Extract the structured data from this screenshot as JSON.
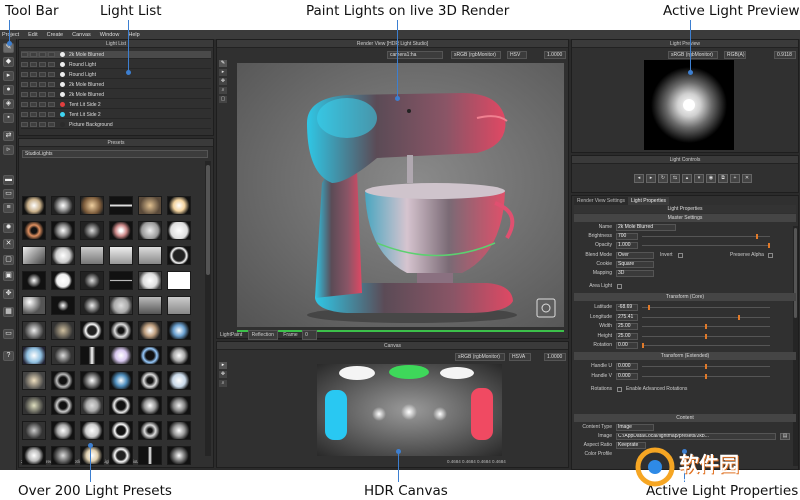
{
  "callouts": {
    "tool_bar": "Tool Bar",
    "light_list": "Light List",
    "paint_lights": "Paint Lights on live 3D Render",
    "active_preview": "Active Light Preview",
    "presets": "Over 200 Light Presets",
    "hdr_canvas": "HDR Canvas",
    "active_props": "Active Light Properties"
  },
  "menu": [
    "Project",
    "Edit",
    "Create",
    "Canvas",
    "Window",
    "Help"
  ],
  "light_list": {
    "title": "Light List",
    "rows": [
      {
        "name": "2k Mole Blurred",
        "color": "#eeeeee",
        "selected": true
      },
      {
        "name": "Round Light",
        "color": "#eeeeee"
      },
      {
        "name": "Round Light",
        "color": "#eeeeee"
      },
      {
        "name": "2k Mole Blurred",
        "color": "#eeeeee"
      },
      {
        "name": "2k Mole Blurred",
        "color": "#eeeeee"
      },
      {
        "name": "Tent Lit Side 2",
        "color": "#e04040"
      },
      {
        "name": "Tent Lit Side 2",
        "color": "#3fd4f0"
      },
      {
        "name": "Picture Background",
        "color": "#2b2b2b"
      }
    ]
  },
  "presets": {
    "title": "Presets",
    "category": "StudioLights",
    "status": "2k Mole Blurred - Tags: Spotlight, PictureLightHFA, StudioLights"
  },
  "render_view": {
    "title": "Render View [HDR Light Studio]",
    "camera": "camera1:ha",
    "colorspace": "sRGB (rgbMonitor)",
    "format": "HSV",
    "zoom": "1.0000",
    "lightpaint_label": "LightPaint",
    "lightpaint_mode": "Reflection",
    "frame_label": "Frame",
    "frame_value": "0"
  },
  "canvas": {
    "title": "Canvas",
    "colorspace": "sRGB (rgbMonitor)",
    "format": "HSVA",
    "zoom": "1.0000",
    "pixel_info": "0.4684 0.4684 0.4684 0.4684"
  },
  "light_preview": {
    "title": "Light Preview",
    "colorspace": "sRGB (rgbMonitor)",
    "format": "RGB(A)",
    "zoom": "0.9118"
  },
  "light_controls": {
    "title": "Light Controls"
  },
  "properties": {
    "tabs": [
      "Render View Settings",
      "Light Properties"
    ],
    "header": "Light Properties",
    "master_settings": "Master Settings",
    "fields": {
      "name_label": "Name",
      "name_value": "2k Mole Blurred",
      "brightness_label": "Brightness",
      "brightness_value": "700",
      "opacity_label": "Opacity",
      "opacity_value": "1.000",
      "blend_label": "Blend Mode",
      "blend_value": "Over",
      "invert_label": "Invert",
      "preserve_alpha_label": "Preserve Alpha",
      "cookie_label": "Cookie",
      "cookie_value": "Square",
      "mapping_label": "Mapping",
      "mapping_value": "3D",
      "area_light_label": "Area Light"
    },
    "transform_core": "Transform (Core)",
    "core": [
      {
        "label": "Latitude",
        "value": "-68.69",
        "pos": 0.05
      },
      {
        "label": "Longitude",
        "value": "275.41",
        "pos": 0.76
      },
      {
        "label": "Width",
        "value": "25.00",
        "pos": 0.5
      },
      {
        "label": "Height",
        "value": "25.00",
        "pos": 0.5
      },
      {
        "label": "Rotation",
        "value": "0.00",
        "pos": 0.0
      }
    ],
    "transform_ext": "Transform (Extended)",
    "extended": [
      {
        "label": "Handle U",
        "value": "0.000"
      },
      {
        "label": "Handle V",
        "value": "0.000"
      }
    ],
    "rotations_label": "Rotations",
    "rotations_check": "Enable Advanced Rotations",
    "content": "Content",
    "content_type_label": "Content Type",
    "content_type_value": "Image",
    "image_label": "Image",
    "image_path": "C:/AppData/Local/lightmap/presets/2kb...",
    "aspect_label": "Aspect Ratio",
    "aspect_value": "Keeprate",
    "color_profile_label": "Color Profile"
  },
  "watermark": {
    "text": "软件园",
    "sub": "CR173.com"
  }
}
